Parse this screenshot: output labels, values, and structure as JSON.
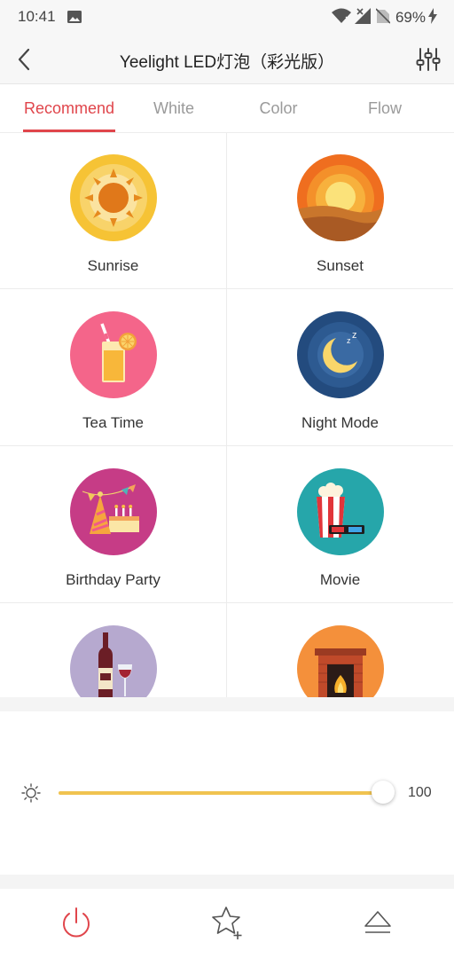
{
  "status_bar": {
    "time": "10:41",
    "battery": "69%"
  },
  "header": {
    "title": "Yeelight LED灯泡（彩光版）"
  },
  "tabs": [
    {
      "label": "Recommend",
      "active": true
    },
    {
      "label": "White",
      "active": false
    },
    {
      "label": "Color",
      "active": false
    },
    {
      "label": "Flow",
      "active": false
    }
  ],
  "scenes": [
    {
      "label": "Sunrise",
      "icon": "sunrise-icon"
    },
    {
      "label": "Sunset",
      "icon": "sunset-icon"
    },
    {
      "label": "Tea Time",
      "icon": "tea-time-icon"
    },
    {
      "label": "Night Mode",
      "icon": "night-mode-icon"
    },
    {
      "label": "Birthday Party",
      "icon": "birthday-party-icon"
    },
    {
      "label": "Movie",
      "icon": "movie-icon"
    },
    {
      "label": "",
      "icon": "wine-icon"
    },
    {
      "label": "",
      "icon": "fireplace-icon"
    }
  ],
  "brightness": {
    "value": "100",
    "level": 1.0
  },
  "colors": {
    "accent": "#e0454b",
    "slider": "#f0c350"
  }
}
